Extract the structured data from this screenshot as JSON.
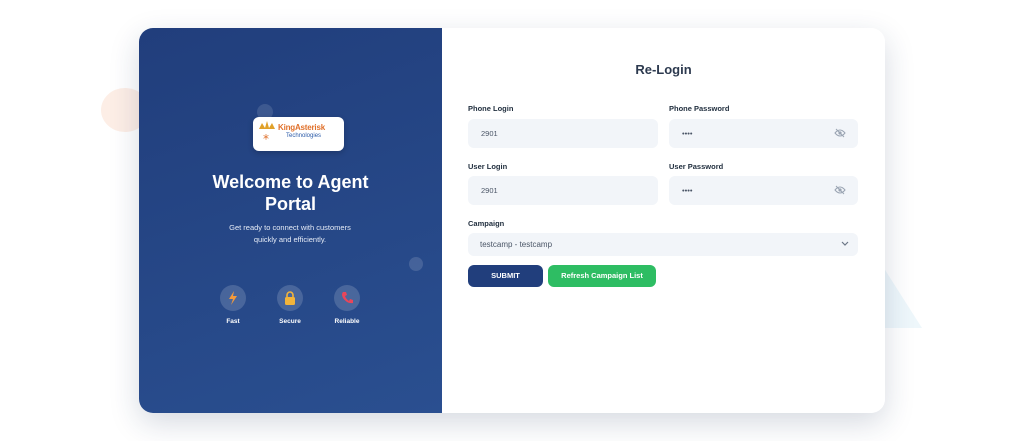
{
  "left_panel": {
    "logo_text": "KingAsterisk",
    "logo_sub": "Technologies",
    "welcome_line1": "Welcome to Agent",
    "welcome_line2": "Portal",
    "tagline_line1": "Get ready to connect with customers",
    "tagline_line2": "quickly and efficiently.",
    "features": [
      {
        "label": "Fast",
        "icon": "bolt-icon"
      },
      {
        "label": "Secure",
        "icon": "lock-icon"
      },
      {
        "label": "Reliable",
        "icon": "phone-icon"
      }
    ]
  },
  "form": {
    "title": "Re-Login",
    "phone_login": {
      "label": "Phone Login",
      "value": "2901"
    },
    "phone_password": {
      "label": "Phone Password",
      "value": "••••"
    },
    "user_login": {
      "label": "User Login",
      "value": "2901"
    },
    "user_password": {
      "label": "User Password",
      "value": "••••"
    },
    "campaign": {
      "label": "Campaign",
      "selected": "testcamp - testcamp"
    },
    "submit_label": "SUBMIT",
    "refresh_label": "Refresh Campaign List"
  },
  "colors": {
    "panel_blue": "#213e7c",
    "submit_blue": "#213e7c",
    "refresh_green": "#2ebd63",
    "logo_orange": "#e0702a"
  }
}
